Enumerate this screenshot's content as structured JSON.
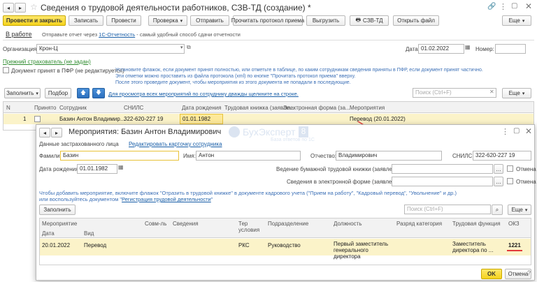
{
  "main": {
    "title": "Сведения о трудовой деятельности работников, СЗВ-ТД (создание) *",
    "toolbar": {
      "post_close": "Провести и закрыть",
      "save": "Записать",
      "post": "Провести",
      "check": "Проверка",
      "send": "Отправить",
      "read_protocol": "Прочитать протокол приема",
      "upload": "Выгрузить",
      "szv_td": "СЗВ-ТД",
      "open_file": "Открыть файл",
      "more": "Еще"
    },
    "status_label": "В работе",
    "status_text_pre": "Отправьте отчет через ",
    "status_link": "1С-Отчетность",
    "status_text_post": " - самый удобный способ сдачи отчетности",
    "org_label": "Организация:",
    "org_value": "Крон-Ц",
    "date_label": "Дата:",
    "date_value": "01.02.2022",
    "number_label": "Номер:",
    "number_value": "",
    "prev_insurer": "Прежний страхователь (не задан)",
    "accepted_pfr": "Документ принят в ПФР (не редактируется)",
    "hint_lines": [
      "Установите флажок, если документ принят полностью, или отметьте в таблице, по каким сотрудникам сведения приняты в ПФР, если документ принят частично.",
      "Эти отметки можно проставить из файла протокола (xml) по кнопке \"Прочитать протокол приема\" вверху.",
      "После этого проведите документ, чтобы мероприятия из этого документа не попадали в последующие."
    ],
    "fill_btn": "Заполнить",
    "select_btn": "Подбор",
    "events_hint": "Для просмотра всех мероприятий по сотруднику дважды щелкните на строке.",
    "search_placeholder": "Поиск (Ctrl+F)",
    "table": {
      "headers": [
        "N",
        "Принято",
        "Сотрудник",
        "СНИЛС",
        "Дата рождения",
        "Трудовая книжка (заявле...",
        "Электронная форма (за...",
        "Мероприятия"
      ],
      "row": {
        "n": "1",
        "employee": "Базин Антон Владимир...",
        "snils": "322-620-227 19",
        "birth": "01.01.1982",
        "events": "Перевод (20.01.2022)"
      }
    }
  },
  "dialog": {
    "title": "Мероприятия: Базин Антон Владимирович",
    "insured_label": "Данные застрахованного лица",
    "edit_card_link": "Редактировать карточку сотрудника",
    "surname_label": "Фамилия:",
    "surname_value": "Базин",
    "name_label": "Имя:",
    "name_value": "Антон",
    "patronymic_label": "Отчество:",
    "patronymic_value": "Владимирович",
    "snils_label": "СНИЛС:",
    "snils_value": "322-620-227 19",
    "birth_label": "Дата рождения:",
    "birth_value": "01.01.1982",
    "paper_label": "Ведение бумажной трудовой книжки (заявление):",
    "electronic_label": "Сведения в электронной форме (заявление):",
    "cancel1": "Отмена",
    "cancel2": "Отмена",
    "hint_line1": "Чтобы добавить мероприятие, включите флажок \"Отразить в трудовой книжке\" в документе кадрового учета (\"Прием на работу\", \"Кадровый перевод\", \"Увольнение\" и др.)",
    "hint_line2_pre": "или воспользуйтесь документом \"",
    "hint_line2_link": "Регистрация трудовой деятельности",
    "hint_line2_post": "\"",
    "fill_btn": "Заполнить",
    "search_placeholder": "Поиск (Ctrl+F)",
    "more": "Еще",
    "table": {
      "h_event": "Мероприятие",
      "h_date": "Дата",
      "h_type": "Вид",
      "h_combo": "Совм-ль",
      "h_info": "Сведения",
      "h_terms": "Тер условия",
      "h_division": "Подразделение",
      "h_position": "Должность",
      "h_category": "Разряд категория",
      "h_function": "Трудовая функция",
      "h_okz": "ОКЗ",
      "row": {
        "date": "20.01.2022",
        "type": "Перевод",
        "terms": "РКС",
        "division": "Руководство",
        "position": "Первый заместитель генерального директора",
        "function": "Заместитель директора по ...",
        "okz": "1221"
      }
    },
    "ok": "OK",
    "cancel": "Отмена"
  },
  "watermark": {
    "brand": "БухЭксперт",
    "digit": "8",
    "tagline": "База ответов по 1С"
  }
}
